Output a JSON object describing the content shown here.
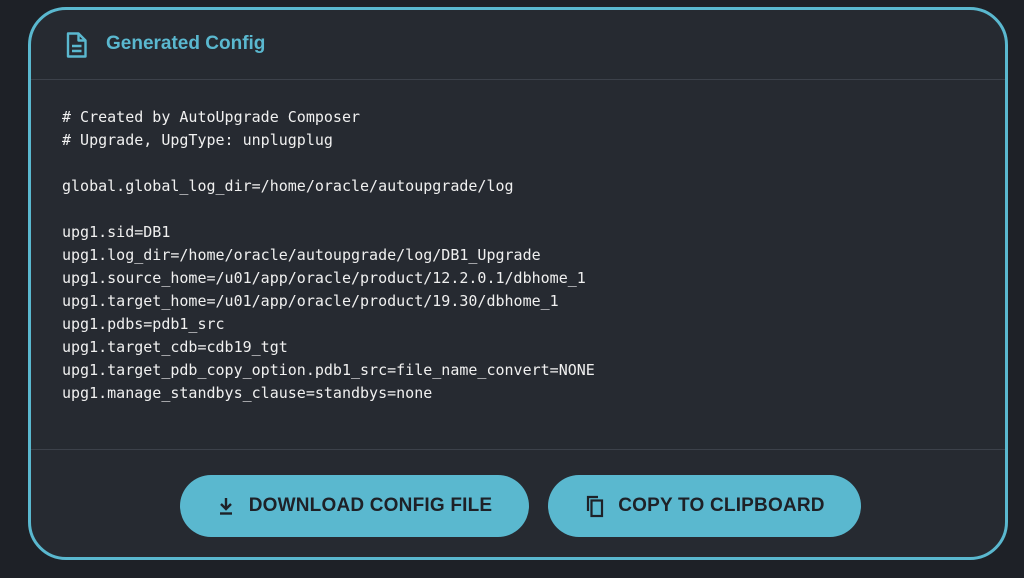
{
  "header": {
    "title": "Generated Config",
    "icon": "document-icon"
  },
  "config_lines": [
    "# Created by AutoUpgrade Composer",
    "# Upgrade, UpgType: unplugplug",
    "",
    "global.global_log_dir=/home/oracle/autoupgrade/log",
    "",
    "upg1.sid=DB1",
    "upg1.log_dir=/home/oracle/autoupgrade/log/DB1_Upgrade",
    "upg1.source_home=/u01/app/oracle/product/12.2.0.1/dbhome_1",
    "upg1.target_home=/u01/app/oracle/product/19.30/dbhome_1",
    "upg1.pdbs=pdb1_src",
    "upg1.target_cdb=cdb19_tgt",
    "upg1.target_pdb_copy_option.pdb1_src=file_name_convert=NONE",
    "upg1.manage_standbys_clause=standbys=none"
  ],
  "actions": {
    "download_label": "DOWNLOAD CONFIG FILE",
    "download_icon": "download-icon",
    "copy_label": "COPY TO CLIPBOARD",
    "copy_icon": "copy-icon"
  },
  "colors": {
    "accent": "#5ab8cf",
    "background": "#1e2127",
    "card": "#262a31",
    "text": "#f0f0f0"
  }
}
